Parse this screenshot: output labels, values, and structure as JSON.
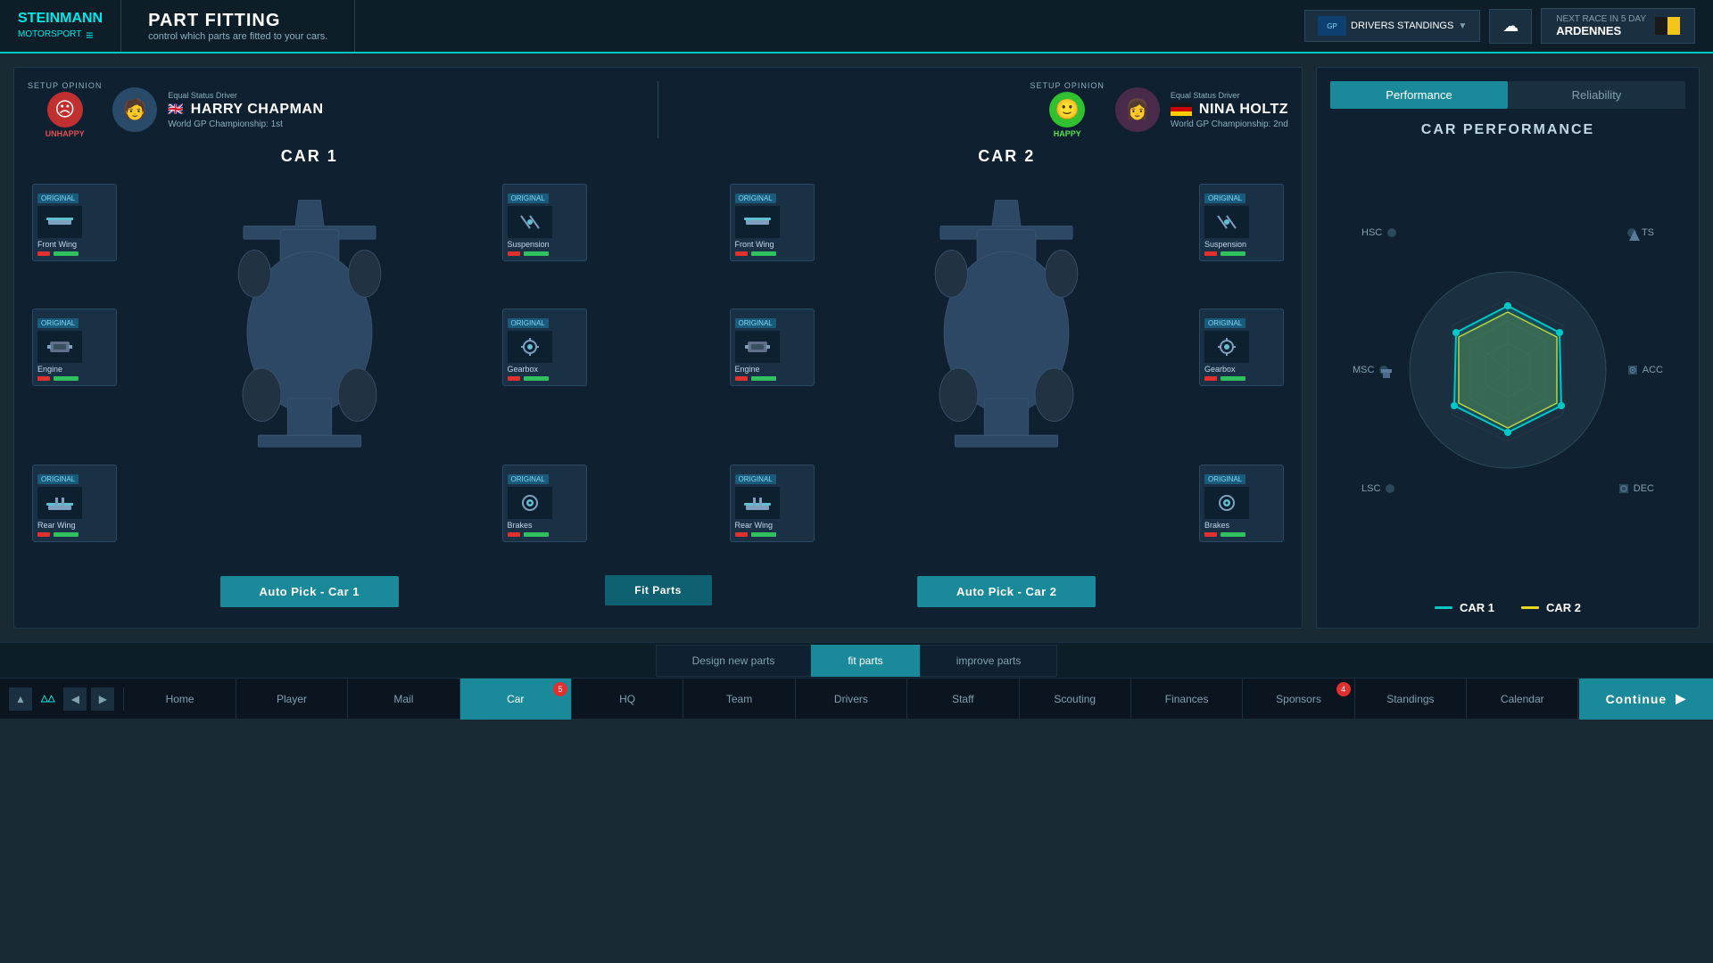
{
  "header": {
    "logo_line1": "STEINMANN",
    "logo_line2": "MOTORSPORT",
    "page_title": "PART FITTING",
    "page_subtitle": "control which parts are fitted to your cars.",
    "drivers_standings_btn": "DRIVERS STANDINGS",
    "weather_label": "weather",
    "next_race_label": "NEXT RACE IN 5 DAY",
    "next_race_location": "ARDENNES"
  },
  "driver1": {
    "opinion_label": "SETUP OPINION",
    "status": "Equal Status Driver",
    "name": "HARRY CHAPMAN",
    "standing": "World GP Championship: 1st",
    "mood": "UNHAPPY",
    "mood_type": "unhappy"
  },
  "driver2": {
    "opinion_label": "SETUP OPINION",
    "status": "Equal Status Driver",
    "name": "NINA HOLTZ",
    "standing": "World GP Championship: 2nd",
    "mood": "HAPPY",
    "mood_type": "happy"
  },
  "car1": {
    "label": "CAR 1",
    "parts": [
      {
        "badge": "ORIGINAL",
        "name": "Front Wing",
        "icon": "🔧",
        "position": "top-left"
      },
      {
        "badge": "ORIGINAL",
        "name": "Suspension",
        "icon": "⚙",
        "position": "top-right"
      },
      {
        "badge": "ORIGINAL",
        "name": "Engine",
        "icon": "🔩",
        "position": "mid-left"
      },
      {
        "badge": "ORIGINAL",
        "name": "Gearbox",
        "icon": "⚙",
        "position": "mid-right"
      },
      {
        "badge": "ORIGINAL",
        "name": "Rear Wing",
        "icon": "🔧",
        "position": "bot-left"
      },
      {
        "badge": "ORIGINAL",
        "name": "Brakes",
        "icon": "⊙",
        "position": "bot-right"
      }
    ],
    "auto_pick_btn": "Auto Pick - Car 1"
  },
  "car2": {
    "label": "CAR 2",
    "parts": [
      {
        "badge": "ORIGINAL",
        "name": "Front Wing",
        "icon": "🔧",
        "position": "top-left"
      },
      {
        "badge": "ORIGINAL",
        "name": "Suspension",
        "icon": "⚙",
        "position": "top-right"
      },
      {
        "badge": "ORIGINAL",
        "name": "Engine",
        "icon": "🔩",
        "position": "mid-left"
      },
      {
        "badge": "ORIGINAL",
        "name": "Gearbox",
        "icon": "⚙",
        "position": "mid-right"
      },
      {
        "badge": "ORIGINAL",
        "name": "Rear Wing",
        "icon": "🔧",
        "position": "bot-left"
      },
      {
        "badge": "ORIGINAL",
        "name": "Brakes",
        "icon": "⊙",
        "position": "bot-right"
      }
    ],
    "auto_pick_btn": "Auto Pick - Car 2"
  },
  "fit_parts_btn": "Fit Parts",
  "performance": {
    "tab_performance": "Performance",
    "tab_reliability": "Reliability",
    "title": "CAR PERFORMANCE",
    "labels": {
      "hsc": "HSC",
      "ts": "TS",
      "msc": "MSC",
      "acc": "ACC",
      "lsc": "LSC",
      "dec": "DEC"
    },
    "legend": {
      "car1_label": "CAR 1",
      "car2_label": "CAR 2",
      "car1_color": "#00d8d8",
      "car2_color": "#e8d820"
    }
  },
  "bottom_tabs": [
    {
      "label": "Design new parts",
      "active": false
    },
    {
      "label": "fit parts",
      "active": true
    },
    {
      "label": "improve parts",
      "active": false
    }
  ],
  "nav": {
    "items": [
      {
        "label": "Home",
        "badge": null,
        "active": false
      },
      {
        "label": "Player",
        "badge": null,
        "active": false
      },
      {
        "label": "Mail",
        "badge": null,
        "active": false
      },
      {
        "label": "Car",
        "badge": "5",
        "active": true
      },
      {
        "label": "HQ",
        "badge": null,
        "active": false
      },
      {
        "label": "Team",
        "badge": null,
        "active": false
      },
      {
        "label": "Drivers",
        "badge": null,
        "active": false
      },
      {
        "label": "Staff",
        "badge": null,
        "active": false
      },
      {
        "label": "Scouting",
        "badge": null,
        "active": false
      },
      {
        "label": "Finances",
        "badge": null,
        "active": false
      },
      {
        "label": "Sponsors",
        "badge": "4",
        "active": false
      },
      {
        "label": "Standings",
        "badge": null,
        "active": false
      },
      {
        "label": "Calendar",
        "badge": null,
        "active": false
      }
    ],
    "continue_btn": "Continue"
  }
}
